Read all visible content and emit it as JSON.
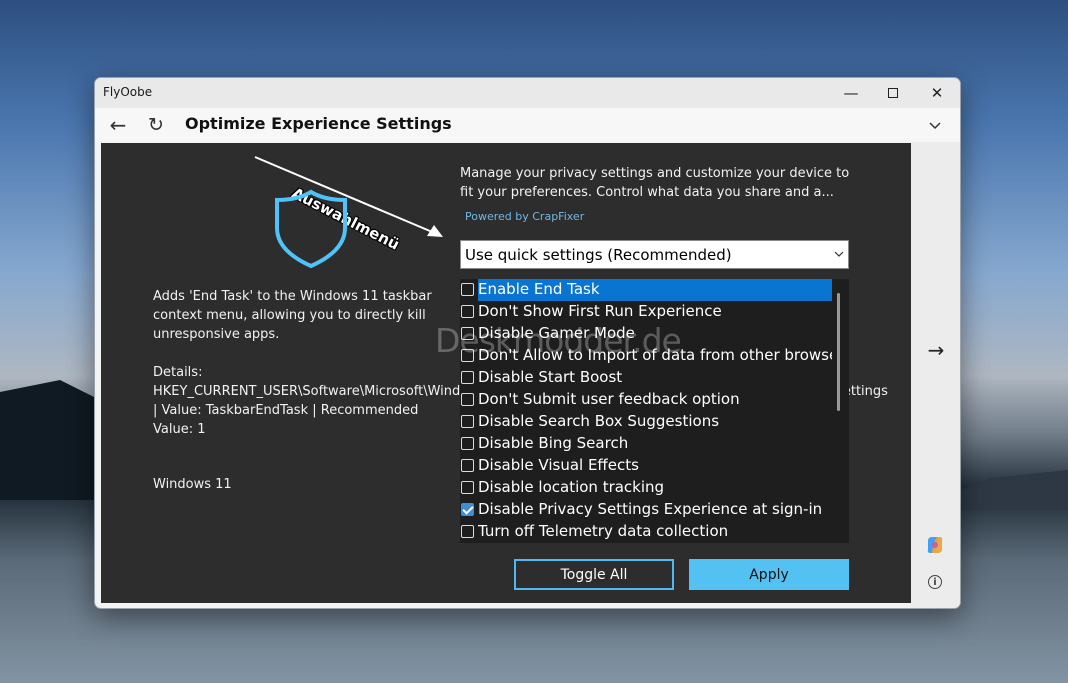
{
  "window": {
    "app_title": "FlyOobe",
    "controls": {
      "minimize": "—",
      "close": "✕"
    }
  },
  "navbar": {
    "back_icon": "←",
    "refresh_icon": "↻",
    "page_title": "Optimize Experience Settings"
  },
  "left_panel": {
    "annotation": "Auswahlmenü",
    "description": "Adds 'End Task' to the Windows 11 taskbar context menu, allowing you to directly kill unresponsive apps.",
    "details_heading": "Details:",
    "details_text": "HKEY_CURRENT_USER\\Software\\Microsoft\\Windows\\CurrentVersion\\Explorer\\Advanced\\TaskbarDeveloperSettings | Value: TaskbarEndTask | Recommended Value: 1",
    "os": "Windows 11"
  },
  "right_panel": {
    "intro": "Manage your privacy settings and customize your device to fit your preferences. Control what data you share and a...",
    "powered_by": "Powered by CrapFixer",
    "preset_selected": "Use quick settings (Recommended)",
    "watermark": "Deskmodder.de",
    "options": [
      {
        "label": "Enable End Task",
        "checked": false,
        "selected": true
      },
      {
        "label": "Don't Show First Run Experience",
        "checked": false,
        "selected": false
      },
      {
        "label": "Disable Gamer Mode",
        "checked": false,
        "selected": false
      },
      {
        "label": "Don't Allow to Import of data from other browsers c",
        "checked": false,
        "selected": false
      },
      {
        "label": "Disable Start Boost",
        "checked": false,
        "selected": false
      },
      {
        "label": "Don't Submit user feedback option",
        "checked": false,
        "selected": false
      },
      {
        "label": "Disable Search Box Suggestions",
        "checked": false,
        "selected": false
      },
      {
        "label": "Disable Bing Search",
        "checked": false,
        "selected": false
      },
      {
        "label": "Disable Visual Effects",
        "checked": false,
        "selected": false
      },
      {
        "label": "Disable location tracking",
        "checked": false,
        "selected": false
      },
      {
        "label": "Disable Privacy Settings Experience at sign-in",
        "checked": true,
        "selected": false
      },
      {
        "label": "Turn off Telemetry data collection",
        "checked": false,
        "selected": false
      }
    ],
    "toggle_all_label": "Toggle All",
    "apply_label": "Apply"
  },
  "side_strip": {
    "next_icon": "→",
    "info_icon": "i"
  },
  "colors": {
    "accent": "#53c2f3",
    "selection": "#0a74d1",
    "panel_bg": "#2d2d2d",
    "shield": "#4fc3f7"
  },
  "icons": [
    "back-arrow-icon",
    "refresh-icon",
    "chevron-down-icon",
    "shield-icon",
    "next-arrow-icon",
    "copilot-icon",
    "info-icon"
  ]
}
